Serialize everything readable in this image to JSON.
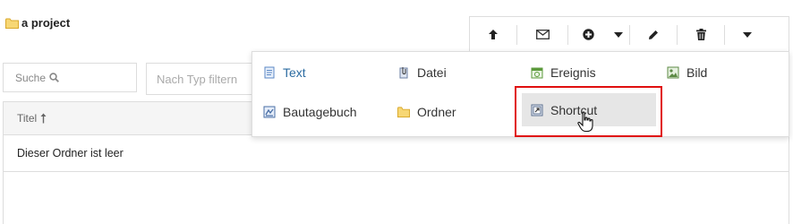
{
  "project": {
    "title": "a project",
    "icon": "folder-icon"
  },
  "toolbar": {
    "buttons": [
      {
        "name": "up-arrow-icon"
      },
      {
        "name": "envelope-icon"
      },
      {
        "name": "plus-circle-icon"
      },
      {
        "name": "caret-down-icon"
      },
      {
        "name": "pencil-icon"
      },
      {
        "name": "trash-icon"
      },
      {
        "name": "caret-down-icon"
      }
    ]
  },
  "search": {
    "placeholder": "Suche",
    "icon": "search-icon"
  },
  "filter": {
    "placeholder": "Nach Typ filtern"
  },
  "table": {
    "column_title": "Titel",
    "sort_icon": "sort-asc-icon",
    "empty_message": "Dieser Ordner ist leer"
  },
  "dropdown": {
    "items": [
      {
        "label": "Text",
        "icon": "document-text-icon",
        "color": "#2d6ca2"
      },
      {
        "label": "Datei",
        "icon": "file-clip-icon",
        "color": "#333333"
      },
      {
        "label": "Ereignis",
        "icon": "calendar-event-icon",
        "color": "#333333"
      },
      {
        "label": "Bild",
        "icon": "image-icon",
        "color": "#333333"
      },
      {
        "label": "Bautagebuch",
        "icon": "logbook-icon",
        "color": "#333333"
      },
      {
        "label": "Ordner",
        "icon": "folder-icon",
        "color": "#333333"
      },
      {
        "label": "Shortcut",
        "icon": "shortcut-icon",
        "color": "#333333"
      }
    ],
    "highlight_color": "#e01010"
  }
}
